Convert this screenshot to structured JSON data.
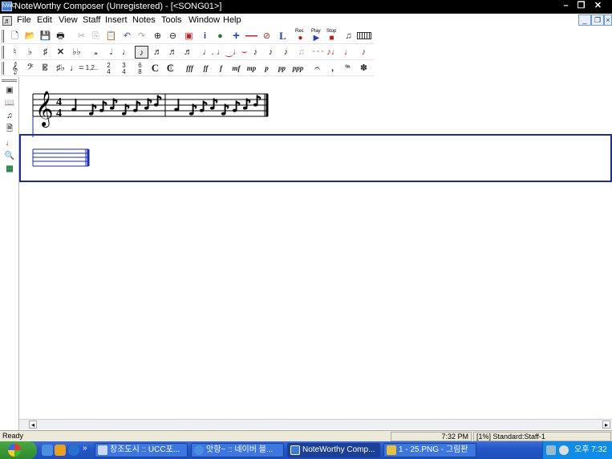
{
  "window": {
    "title": "NoteWorthy Composer (Unregistered) - [<SONG01>]",
    "icon": "nwc-app-icon"
  },
  "menu": [
    "File",
    "Edit",
    "View",
    "Staff",
    "Insert",
    "Notes",
    "Tools",
    "Window",
    "Help"
  ],
  "toolbar1": {
    "rec": "Rec",
    "play": "Play",
    "stop": "Stop"
  },
  "toolbar2": {
    "tuplet": "1,2.."
  },
  "toolbar3": {
    "fff": "fff",
    "ff": "ff",
    "f": "f",
    "mf": "mf",
    "mp": "mp",
    "p": "p",
    "pp": "pp",
    "ppp": "ppp"
  },
  "score": {
    "time_top": "4",
    "time_bottom": "4"
  },
  "status": {
    "ready": "Ready",
    "time": "7:32 PM",
    "info": "[1%] Standard:Staff-1"
  },
  "taskbar": {
    "tasks": [
      {
        "label": "창조도시 :: UCC포..."
      },
      {
        "label": "앗항~ :: 네이버 블..."
      },
      {
        "label": "NoteWorthy Comp..."
      },
      {
        "label": "1 - 25.PNG - 그림판"
      }
    ],
    "clock": "오후 7:32"
  },
  "colors": {
    "titlebar": "#000000",
    "selection": "#1a2ab8",
    "taskbar": "#2457c8"
  }
}
